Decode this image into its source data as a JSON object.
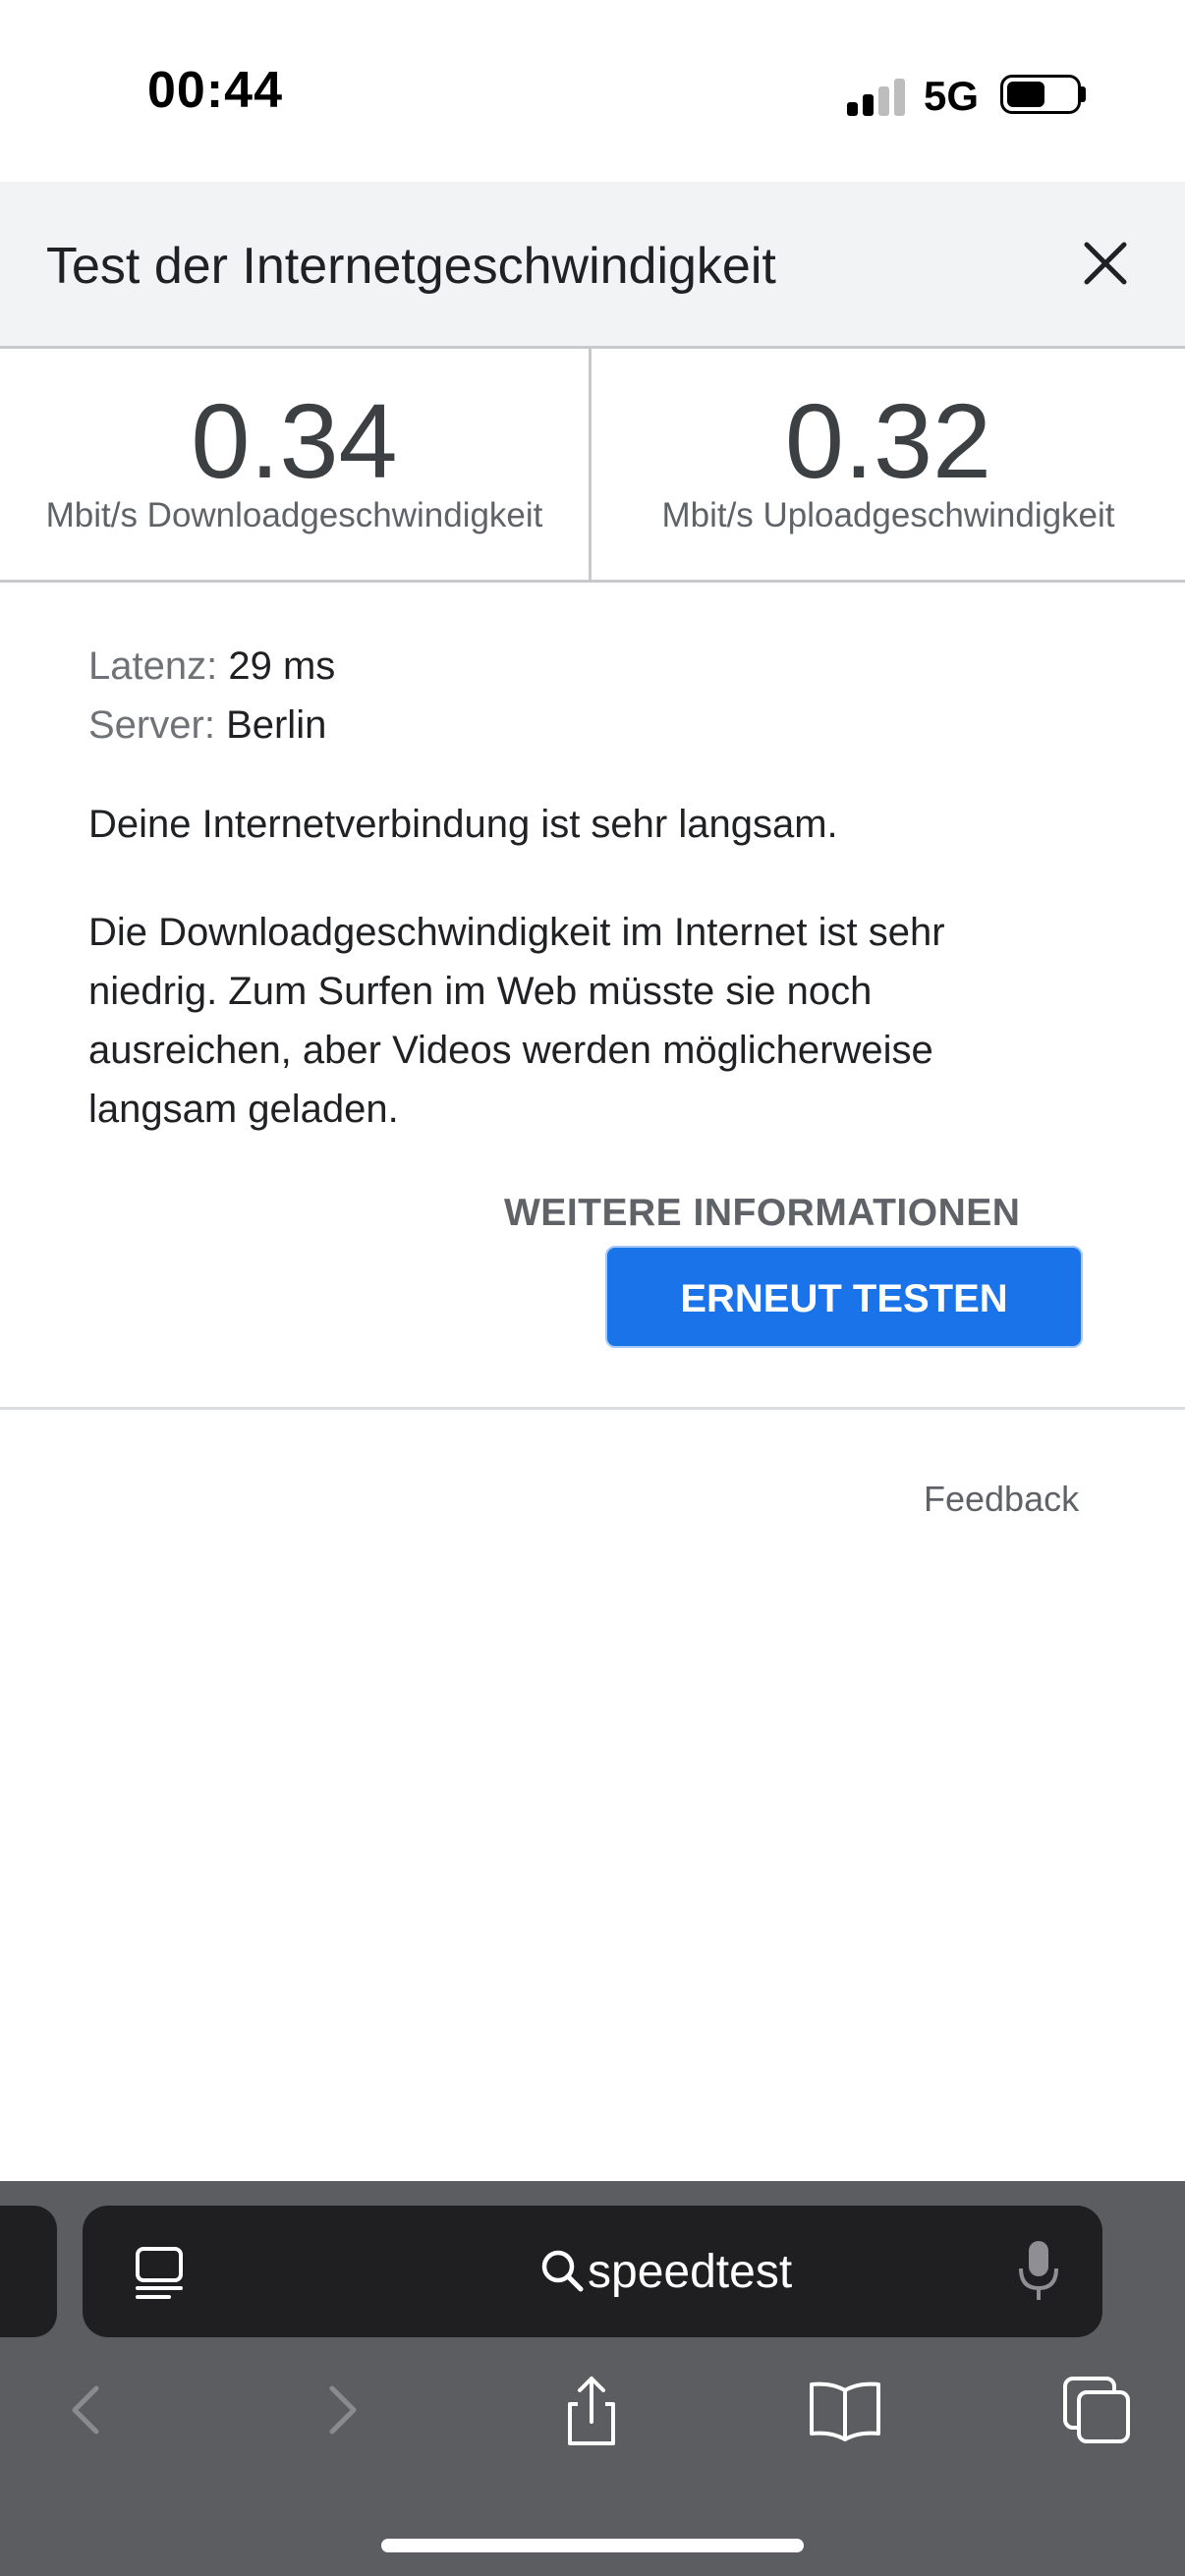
{
  "status_bar": {
    "time": "00:44",
    "network": "5G"
  },
  "header": {
    "title": "Test der Internetgeschwindigkeit"
  },
  "metrics": {
    "download": {
      "value": "0.34",
      "label": "Mbit/s Downloadgeschwindigkeit"
    },
    "upload": {
      "value": "0.32",
      "label": "Mbit/s Uploadgeschwindigkeit"
    }
  },
  "details": {
    "latency_key": "Latenz:",
    "latency_value": "29 ms",
    "server_key": "Server:",
    "server_value": "Berlin",
    "status": "Deine Internetverbindung ist sehr langsam.",
    "description": "Die Downloadgeschwindigkeit im Internet ist sehr niedrig. Zum Surfen im Web müsste sie noch ausreichen, aber Videos werden möglicherweise langsam geladen."
  },
  "actions": {
    "more_info": "WEITERE INFORMATIONEN",
    "retest": "ERNEUT TESTEN",
    "feedback": "Feedback"
  },
  "browser": {
    "address_text": "speedtest"
  },
  "colors": {
    "primary_button": "#1a73e8",
    "header_bg": "#f1f3f4",
    "browser_chrome": "#5c5d60"
  },
  "icons": [
    "signal-icon",
    "battery-icon",
    "close-icon",
    "page-menu-icon",
    "search-icon",
    "mic-icon",
    "back-icon",
    "forward-icon",
    "share-icon",
    "bookmarks-icon",
    "tabs-icon"
  ]
}
